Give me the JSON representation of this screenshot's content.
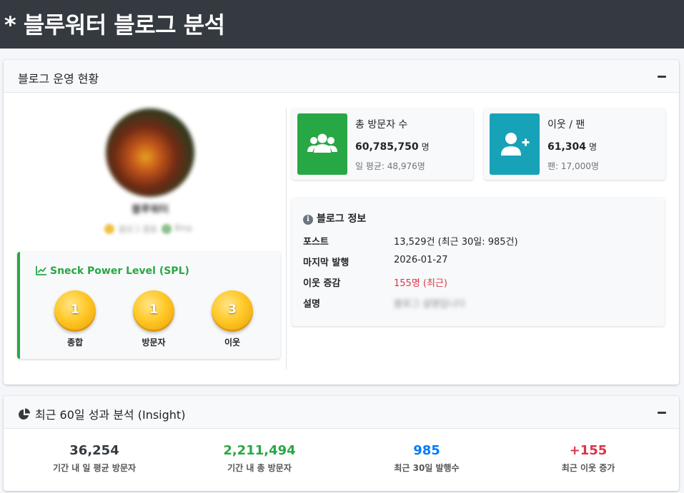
{
  "page": {
    "title": "* 블루워터 블로그 분석"
  },
  "ops_card": {
    "title": "블로그 운영 현황",
    "blog_name": "블루워터",
    "badges": [
      "블로그 활동",
      "Blog"
    ],
    "spl": {
      "title": "Sneck Power Level (SPL)",
      "items": [
        {
          "level": "1",
          "label": "종합"
        },
        {
          "level": "1",
          "label": "방문자"
        },
        {
          "level": "3",
          "label": "이웃"
        }
      ]
    },
    "visitors": {
      "label": "총 방문자 수",
      "value": "60,785,750",
      "unit": "명",
      "sub": "일 평균: 48,976명",
      "color": "#28a745",
      "icon": "users-icon"
    },
    "neighbors": {
      "label": "이웃 / 팬",
      "value": "61,304",
      "unit": "명",
      "sub": "팬: 17,000명",
      "color": "#17a2b8",
      "icon": "user-plus-icon"
    },
    "blog_info": {
      "title": "블로그 정보",
      "rows": [
        {
          "label": "포스트",
          "value": "13,529건 (최근 30일: 985건)"
        },
        {
          "label": "마지막 발행",
          "value": "2026-01-27"
        },
        {
          "label": "이웃 증감",
          "value": "155명 (최근)"
        },
        {
          "label": "설명",
          "value": "블로그 설명입니다"
        }
      ]
    }
  },
  "insight_card": {
    "title": "최근 60일 성과 분석 (Insight)",
    "stats": [
      {
        "value": "36,254",
        "label": "기간 내 일 평균 방문자",
        "color": "#343a40"
      },
      {
        "value": "2,211,494",
        "label": "기간 내 총 방문자",
        "color": "#28a745"
      },
      {
        "value": "985",
        "label": "최근 30일 발행수",
        "color": "#007bff"
      },
      {
        "value": "+155",
        "label": "최근 이웃 증가",
        "color": "#dc3545"
      }
    ]
  }
}
